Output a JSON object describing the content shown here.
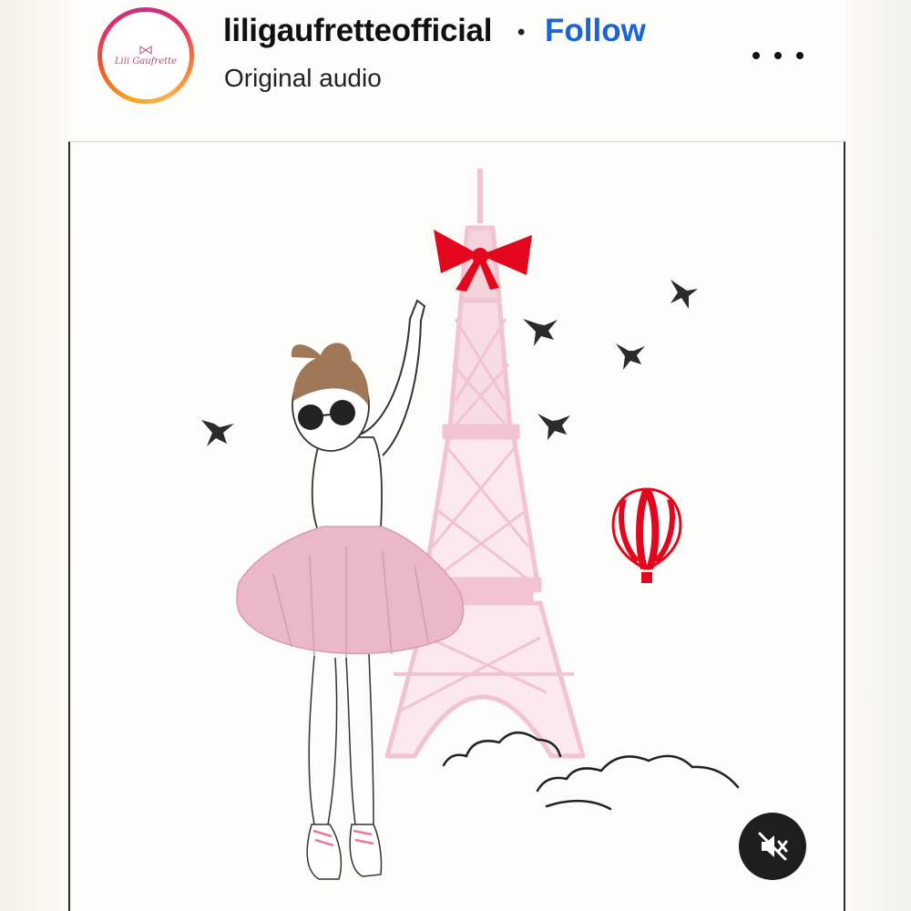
{
  "post": {
    "username": "liligaufretteofficial",
    "separator": "•",
    "follow_label": "Follow",
    "audio_label": "Original audio",
    "avatar_text": "Lili Gaufrette",
    "more_icon": "more-horizontal-icon",
    "mute_icon": "speaker-muted-icon"
  },
  "colors": {
    "follow_blue": "#1a64d4",
    "tower_pink": "#f2c4cf",
    "skirt_pink": "#eab8c6",
    "bow_red": "#e3061d",
    "bird": "#2b2b2b"
  }
}
